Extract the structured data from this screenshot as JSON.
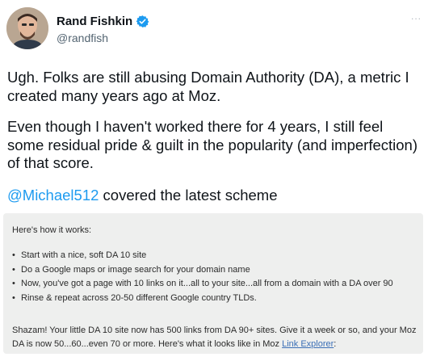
{
  "author": {
    "display_name": "Rand Fishkin",
    "handle": "@randfish",
    "verified": true
  },
  "more_menu": "...",
  "tweet": {
    "paragraph_1": "Ugh. Folks are still abusing Domain Authority (DA), a metric I created many years ago at Moz.",
    "paragraph_2": "Even though I haven't worked there for 4 years, I still feel some residual pride & guilt in the popularity (and imperfection) of that score.",
    "mention": "@Michael512",
    "paragraph_3_rest": " covered the latest scheme"
  },
  "embedded_image": {
    "intro": "Here's how it works:",
    "steps": [
      "Start with a nice, soft DA 10 site",
      "Do a Google maps or image search for your domain name",
      "Now, you've got a page with 10 links on it...all to your site...all from a domain with a DA over 90",
      "Rinse & repeat across 20-50 different Google country TLDs."
    ],
    "outro": "Shazam! Your little DA 10 site now has 500 links from DA 90+ sites. Give it a week or so, and your Moz DA is now 50...60...even 70 or more. Here's what it looks like in Moz ",
    "link_text": "Link Explorer",
    "outro_end": ":"
  },
  "colors": {
    "link_blue": "#1d9bf0",
    "verified_blue": "#1d9bf0",
    "embed_bg": "#eeefee"
  }
}
